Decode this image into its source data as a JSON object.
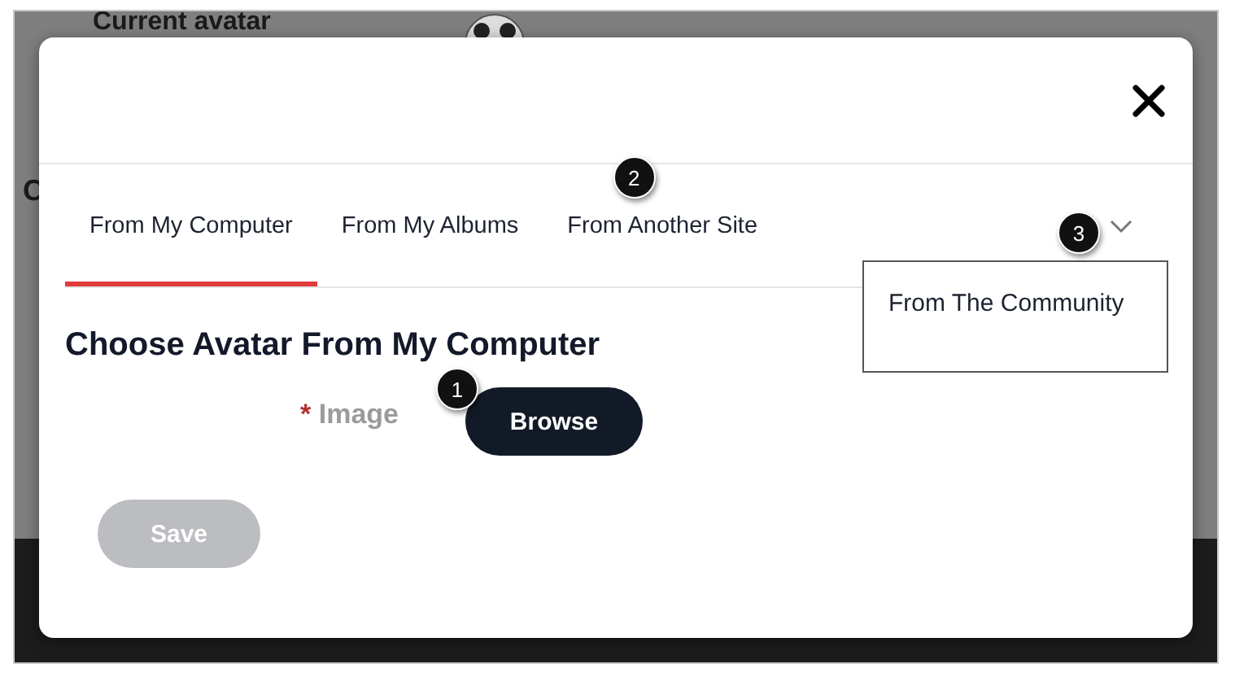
{
  "background": {
    "title": "Current avatar",
    "letter": "C"
  },
  "dialog": {
    "tabs": [
      {
        "label": "From My Computer",
        "selected": true
      },
      {
        "label": "From My Albums",
        "selected": false
      },
      {
        "label": "From Another Site",
        "selected": false,
        "callout": "2"
      }
    ],
    "more_menu": {
      "expanded": true,
      "callout": "3",
      "items": [
        {
          "label": "From The Community"
        }
      ]
    },
    "heading": "Choose Avatar From My Computer",
    "field": {
      "required_mark": "*",
      "label": "Image",
      "button": "Browse",
      "callout": "1"
    },
    "save": {
      "label": "Save",
      "disabled": true
    }
  }
}
